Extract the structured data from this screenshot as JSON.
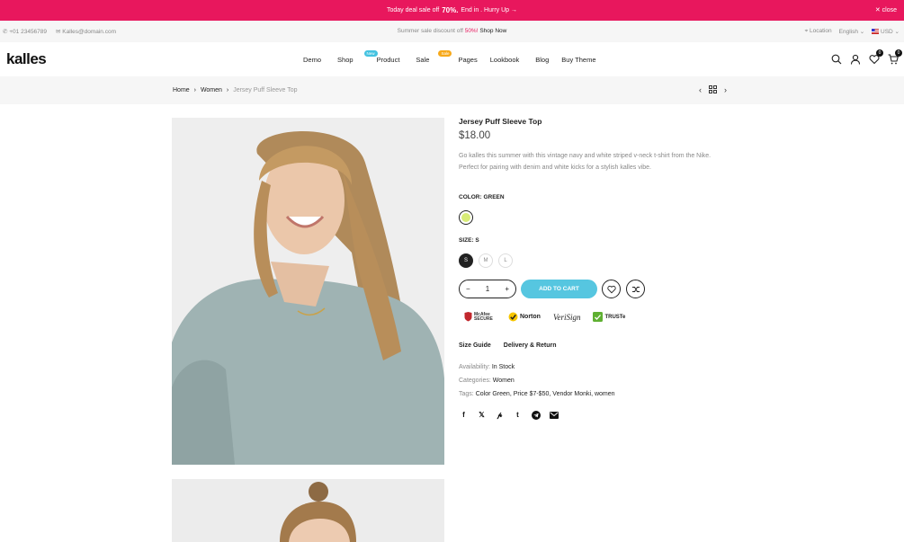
{
  "promo": {
    "text_before": "Today deal sale off",
    "percent": "70%.",
    "text_after": "End in . Hurry Up →",
    "close": "✕ close"
  },
  "topbar": {
    "phone": "+01 23456789",
    "email": "Kalles@domain.com",
    "sale_text": "Summer sale discount off",
    "sale_pct": "50%!",
    "shop_now": "Shop Now",
    "location": "Location",
    "language": "English ⌄",
    "currency": "USD ⌄"
  },
  "header": {
    "logo": "kalles",
    "nav": [
      {
        "label": "Demo",
        "badge": ""
      },
      {
        "label": "Shop",
        "badge": "New"
      },
      {
        "label": "Product",
        "badge": ""
      },
      {
        "label": "Sale",
        "badge": "Sale"
      },
      {
        "label": "Pages",
        "badge": ""
      },
      {
        "label": "Lookbook",
        "badge": ""
      },
      {
        "label": "Blog",
        "badge": ""
      },
      {
        "label": "Buy Theme",
        "badge": ""
      }
    ],
    "badge_colors": {
      "new": "#44c2e0",
      "sale": "#f7a91a"
    },
    "wishlist_count": "0",
    "cart_count": "0"
  },
  "breadcrumb": {
    "home": "Home",
    "sep": "›",
    "category": "Women",
    "current": "Jersey Puff Sleeve Top"
  },
  "product": {
    "title": "Jersey Puff Sleeve Top",
    "price": "$18.00",
    "description": "Go kalles this summer with this vintage navy and white striped v-neck t-shirt from the Nike. Perfect for pairing with denim and white kicks for a stylish kalles vibe.",
    "color_label": "COLOR: GREEN",
    "size_label": "SIZE: S",
    "sizes": [
      "S",
      "M",
      "L"
    ],
    "quantity": "1",
    "add_to_cart": "ADD TO CART",
    "trust_badges": [
      "McAfee SECURE",
      "Norton",
      "VeriSign",
      "TRUSTe"
    ],
    "size_guide": "Size Guide",
    "delivery": "Delivery & Return",
    "availability_label": "Availability:",
    "availability": "In Stock",
    "categories_label": "Categories:",
    "categories": "Women",
    "tags_label": "Tags:",
    "tags": "Color Green, Price $7-$50, Vendor Monki, women"
  },
  "colors": {
    "accent": "#e8175d",
    "cart_button": "#56c6e0",
    "swatch_green": "#d8ec77"
  }
}
